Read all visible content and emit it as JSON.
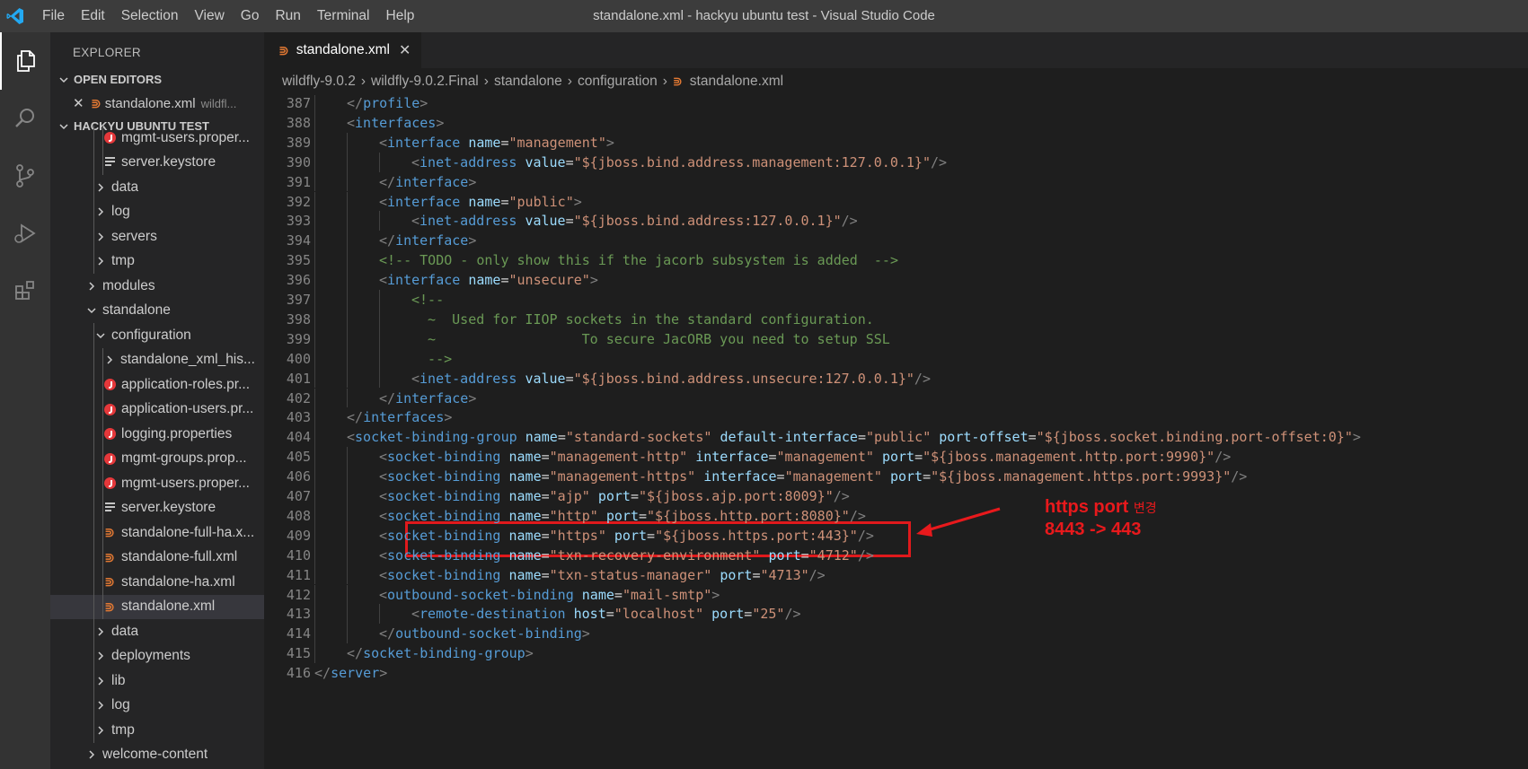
{
  "titlebar": {
    "menu": [
      "File",
      "Edit",
      "Selection",
      "View",
      "Go",
      "Run",
      "Terminal",
      "Help"
    ],
    "window_title": "standalone.xml - hackyu ubuntu test - Visual Studio Code"
  },
  "sidebar": {
    "title": "EXPLORER",
    "open_editors_label": "OPEN EDITORS",
    "open_editor": {
      "name": "standalone.xml",
      "path": "wildfl..."
    },
    "workspace_label": "HACKYU UBUNTU TEST",
    "tree": [
      {
        "label": "mgmt-users.proper...",
        "icon": "java-props-icon",
        "depth": 2
      },
      {
        "label": "server.keystore",
        "icon": "lines-icon",
        "depth": 2
      },
      {
        "label": "data",
        "icon": "chevron-right",
        "depth": 1
      },
      {
        "label": "log",
        "icon": "chevron-right",
        "depth": 1
      },
      {
        "label": "servers",
        "icon": "chevron-right",
        "depth": 1
      },
      {
        "label": "tmp",
        "icon": "chevron-right",
        "depth": 1
      },
      {
        "label": "modules",
        "icon": "chevron-right",
        "depth": 0
      },
      {
        "label": "standalone",
        "icon": "chevron-down",
        "depth": 0
      },
      {
        "label": "configuration",
        "icon": "chevron-down",
        "depth": 1
      },
      {
        "label": "standalone_xml_his...",
        "icon": "chevron-right",
        "depth": 2
      },
      {
        "label": "application-roles.pr...",
        "icon": "java-props-icon",
        "depth": 2
      },
      {
        "label": "application-users.pr...",
        "icon": "java-props-icon",
        "depth": 2
      },
      {
        "label": "logging.properties",
        "icon": "java-props-icon",
        "depth": 2
      },
      {
        "label": "mgmt-groups.prop...",
        "icon": "java-props-icon",
        "depth": 2
      },
      {
        "label": "mgmt-users.proper...",
        "icon": "java-props-icon",
        "depth": 2
      },
      {
        "label": "server.keystore",
        "icon": "lines-icon",
        "depth": 2
      },
      {
        "label": "standalone-full-ha.x...",
        "icon": "rss-icon",
        "depth": 2
      },
      {
        "label": "standalone-full.xml",
        "icon": "rss-icon",
        "depth": 2
      },
      {
        "label": "standalone-ha.xml",
        "icon": "rss-icon",
        "depth": 2
      },
      {
        "label": "standalone.xml",
        "icon": "rss-icon",
        "depth": 2,
        "selected": true
      },
      {
        "label": "data",
        "icon": "chevron-right",
        "depth": 1
      },
      {
        "label": "deployments",
        "icon": "chevron-right",
        "depth": 1
      },
      {
        "label": "lib",
        "icon": "chevron-right",
        "depth": 1
      },
      {
        "label": "log",
        "icon": "chevron-right",
        "depth": 1
      },
      {
        "label": "tmp",
        "icon": "chevron-right",
        "depth": 1
      },
      {
        "label": "welcome-content",
        "icon": "chevron-right",
        "depth": 0
      }
    ]
  },
  "tab": {
    "label": "standalone.xml"
  },
  "breadcrumb": [
    "wildfly-9.0.2",
    "wildfly-9.0.2.Final",
    "standalone",
    "configuration",
    "standalone.xml"
  ],
  "code_lines": [
    {
      "n": "387",
      "indent": 1,
      "tokens": [
        [
          "p",
          "</"
        ],
        [
          "t",
          "profile"
        ],
        [
          "p",
          ">"
        ]
      ]
    },
    {
      "n": "388",
      "indent": 1,
      "tokens": [
        [
          "p",
          "<"
        ],
        [
          "t",
          "interfaces"
        ],
        [
          "p",
          ">"
        ]
      ]
    },
    {
      "n": "389",
      "indent": 2,
      "tokens": [
        [
          "p",
          "<"
        ],
        [
          "t",
          "interface"
        ],
        [
          "x",
          " "
        ],
        [
          "a",
          "name"
        ],
        [
          "e",
          "="
        ],
        [
          "s",
          "\"management\""
        ],
        [
          "p",
          ">"
        ]
      ]
    },
    {
      "n": "390",
      "indent": 3,
      "tokens": [
        [
          "p",
          "<"
        ],
        [
          "t",
          "inet-address"
        ],
        [
          "x",
          " "
        ],
        [
          "a",
          "value"
        ],
        [
          "e",
          "="
        ],
        [
          "s",
          "\"${jboss.bind.address.management:127.0.0.1}\""
        ],
        [
          "p",
          "/>"
        ]
      ]
    },
    {
      "n": "391",
      "indent": 2,
      "tokens": [
        [
          "p",
          "</"
        ],
        [
          "t",
          "interface"
        ],
        [
          "p",
          ">"
        ]
      ]
    },
    {
      "n": "392",
      "indent": 2,
      "tokens": [
        [
          "p",
          "<"
        ],
        [
          "t",
          "interface"
        ],
        [
          "x",
          " "
        ],
        [
          "a",
          "name"
        ],
        [
          "e",
          "="
        ],
        [
          "s",
          "\"public\""
        ],
        [
          "p",
          ">"
        ]
      ]
    },
    {
      "n": "393",
      "indent": 3,
      "tokens": [
        [
          "p",
          "<"
        ],
        [
          "t",
          "inet-address"
        ],
        [
          "x",
          " "
        ],
        [
          "a",
          "value"
        ],
        [
          "e",
          "="
        ],
        [
          "s",
          "\"${jboss.bind.address:127.0.0.1}\""
        ],
        [
          "p",
          "/>"
        ]
      ]
    },
    {
      "n": "394",
      "indent": 2,
      "tokens": [
        [
          "p",
          "</"
        ],
        [
          "t",
          "interface"
        ],
        [
          "p",
          ">"
        ]
      ]
    },
    {
      "n": "395",
      "indent": 2,
      "tokens": [
        [
          "c",
          "<!-- TODO - only show this if the jacorb subsystem is added  -->"
        ]
      ]
    },
    {
      "n": "396",
      "indent": 2,
      "tokens": [
        [
          "p",
          "<"
        ],
        [
          "t",
          "interface"
        ],
        [
          "x",
          " "
        ],
        [
          "a",
          "name"
        ],
        [
          "e",
          "="
        ],
        [
          "s",
          "\"unsecure\""
        ],
        [
          "p",
          ">"
        ]
      ]
    },
    {
      "n": "397",
      "indent": 3,
      "tokens": [
        [
          "c",
          "<!--"
        ]
      ]
    },
    {
      "n": "398",
      "indent": 3,
      "tokens": [
        [
          "c",
          "  ~  Used for IIOP sockets in the standard configuration."
        ]
      ]
    },
    {
      "n": "399",
      "indent": 3,
      "tokens": [
        [
          "c",
          "  ~                  To secure JacORB you need to setup SSL"
        ]
      ]
    },
    {
      "n": "400",
      "indent": 3,
      "tokens": [
        [
          "c",
          "  -->"
        ]
      ]
    },
    {
      "n": "401",
      "indent": 3,
      "tokens": [
        [
          "p",
          "<"
        ],
        [
          "t",
          "inet-address"
        ],
        [
          "x",
          " "
        ],
        [
          "a",
          "value"
        ],
        [
          "e",
          "="
        ],
        [
          "s",
          "\"${jboss.bind.address.unsecure:127.0.0.1}\""
        ],
        [
          "p",
          "/>"
        ]
      ]
    },
    {
      "n": "402",
      "indent": 2,
      "tokens": [
        [
          "p",
          "</"
        ],
        [
          "t",
          "interface"
        ],
        [
          "p",
          ">"
        ]
      ]
    },
    {
      "n": "403",
      "indent": 1,
      "tokens": [
        [
          "p",
          "</"
        ],
        [
          "t",
          "interfaces"
        ],
        [
          "p",
          ">"
        ]
      ]
    },
    {
      "n": "404",
      "indent": 1,
      "tokens": [
        [
          "p",
          "<"
        ],
        [
          "t",
          "socket-binding-group"
        ],
        [
          "x",
          " "
        ],
        [
          "a",
          "name"
        ],
        [
          "e",
          "="
        ],
        [
          "s",
          "\"standard-sockets\""
        ],
        [
          "x",
          " "
        ],
        [
          "a",
          "default-interface"
        ],
        [
          "e",
          "="
        ],
        [
          "s",
          "\"public\""
        ],
        [
          "x",
          " "
        ],
        [
          "a",
          "port-offset"
        ],
        [
          "e",
          "="
        ],
        [
          "s",
          "\"${jboss.socket.binding.port-offset:0}\""
        ],
        [
          "p",
          ">"
        ]
      ]
    },
    {
      "n": "405",
      "indent": 2,
      "tokens": [
        [
          "p",
          "<"
        ],
        [
          "t",
          "socket-binding"
        ],
        [
          "x",
          " "
        ],
        [
          "a",
          "name"
        ],
        [
          "e",
          "="
        ],
        [
          "s",
          "\"management-http\""
        ],
        [
          "x",
          " "
        ],
        [
          "a",
          "interface"
        ],
        [
          "e",
          "="
        ],
        [
          "s",
          "\"management\""
        ],
        [
          "x",
          " "
        ],
        [
          "a",
          "port"
        ],
        [
          "e",
          "="
        ],
        [
          "s",
          "\"${jboss.management.http.port:9990}\""
        ],
        [
          "p",
          "/>"
        ]
      ]
    },
    {
      "n": "406",
      "indent": 2,
      "tokens": [
        [
          "p",
          "<"
        ],
        [
          "t",
          "socket-binding"
        ],
        [
          "x",
          " "
        ],
        [
          "a",
          "name"
        ],
        [
          "e",
          "="
        ],
        [
          "s",
          "\"management-https\""
        ],
        [
          "x",
          " "
        ],
        [
          "a",
          "interface"
        ],
        [
          "e",
          "="
        ],
        [
          "s",
          "\"management\""
        ],
        [
          "x",
          " "
        ],
        [
          "a",
          "port"
        ],
        [
          "e",
          "="
        ],
        [
          "s",
          "\"${jboss.management.https.port:9993}\""
        ],
        [
          "p",
          "/>"
        ]
      ]
    },
    {
      "n": "407",
      "indent": 2,
      "tokens": [
        [
          "p",
          "<"
        ],
        [
          "t",
          "socket-binding"
        ],
        [
          "x",
          " "
        ],
        [
          "a",
          "name"
        ],
        [
          "e",
          "="
        ],
        [
          "s",
          "\"ajp\""
        ],
        [
          "x",
          " "
        ],
        [
          "a",
          "port"
        ],
        [
          "e",
          "="
        ],
        [
          "s",
          "\"${jboss.ajp.port:8009}\""
        ],
        [
          "p",
          "/>"
        ]
      ]
    },
    {
      "n": "408",
      "indent": 2,
      "tokens": [
        [
          "p",
          "<"
        ],
        [
          "t",
          "socket-binding"
        ],
        [
          "x",
          " "
        ],
        [
          "a",
          "name"
        ],
        [
          "e",
          "="
        ],
        [
          "s",
          "\"http\""
        ],
        [
          "x",
          " "
        ],
        [
          "a",
          "port"
        ],
        [
          "e",
          "="
        ],
        [
          "s",
          "\"${jboss.http.port:8080}\""
        ],
        [
          "p",
          "/>"
        ]
      ]
    },
    {
      "n": "409",
      "indent": 2,
      "tokens": [
        [
          "p",
          "<"
        ],
        [
          "t",
          "socket-binding"
        ],
        [
          "x",
          " "
        ],
        [
          "a",
          "name"
        ],
        [
          "e",
          "="
        ],
        [
          "s",
          "\"https\""
        ],
        [
          "x",
          " "
        ],
        [
          "a",
          "port"
        ],
        [
          "e",
          "="
        ],
        [
          "s",
          "\"${jboss.https.port:443}\""
        ],
        [
          "p",
          "/>"
        ]
      ]
    },
    {
      "n": "410",
      "indent": 2,
      "tokens": [
        [
          "p",
          "<"
        ],
        [
          "t",
          "socket-binding"
        ],
        [
          "x",
          " "
        ],
        [
          "a",
          "name"
        ],
        [
          "e",
          "="
        ],
        [
          "s",
          "\"txn-recovery-environment\""
        ],
        [
          "x",
          " "
        ],
        [
          "a",
          "port"
        ],
        [
          "e",
          "="
        ],
        [
          "s",
          "\"4712\""
        ],
        [
          "p",
          "/>"
        ]
      ]
    },
    {
      "n": "411",
      "indent": 2,
      "tokens": [
        [
          "p",
          "<"
        ],
        [
          "t",
          "socket-binding"
        ],
        [
          "x",
          " "
        ],
        [
          "a",
          "name"
        ],
        [
          "e",
          "="
        ],
        [
          "s",
          "\"txn-status-manager\""
        ],
        [
          "x",
          " "
        ],
        [
          "a",
          "port"
        ],
        [
          "e",
          "="
        ],
        [
          "s",
          "\"4713\""
        ],
        [
          "p",
          "/>"
        ]
      ]
    },
    {
      "n": "412",
      "indent": 2,
      "tokens": [
        [
          "p",
          "<"
        ],
        [
          "t",
          "outbound-socket-binding"
        ],
        [
          "x",
          " "
        ],
        [
          "a",
          "name"
        ],
        [
          "e",
          "="
        ],
        [
          "s",
          "\"mail-smtp\""
        ],
        [
          "p",
          ">"
        ]
      ]
    },
    {
      "n": "413",
      "indent": 3,
      "tokens": [
        [
          "p",
          "<"
        ],
        [
          "t",
          "remote-destination"
        ],
        [
          "x",
          " "
        ],
        [
          "a",
          "host"
        ],
        [
          "e",
          "="
        ],
        [
          "s",
          "\"localhost\""
        ],
        [
          "x",
          " "
        ],
        [
          "a",
          "port"
        ],
        [
          "e",
          "="
        ],
        [
          "s",
          "\"25\""
        ],
        [
          "p",
          "/>"
        ]
      ]
    },
    {
      "n": "414",
      "indent": 2,
      "tokens": [
        [
          "p",
          "</"
        ],
        [
          "t",
          "outbound-socket-binding"
        ],
        [
          "p",
          ">"
        ]
      ]
    },
    {
      "n": "415",
      "indent": 1,
      "tokens": [
        [
          "p",
          "</"
        ],
        [
          "t",
          "socket-binding-group"
        ],
        [
          "p",
          ">"
        ]
      ]
    },
    {
      "n": "416",
      "indent": 0,
      "tokens": [
        [
          "p",
          "</"
        ],
        [
          "t",
          "server"
        ],
        [
          "p",
          ">"
        ]
      ]
    }
  ],
  "annotation": {
    "line1_bold": "https port",
    "line1_small": "변경",
    "line2": "8443 -> 443"
  },
  "colors": {
    "tag": "#569cd6",
    "attr": "#9cdcfe",
    "string": "#ce9178",
    "comment": "#6a9955",
    "annotation_red": "#e8191c"
  }
}
